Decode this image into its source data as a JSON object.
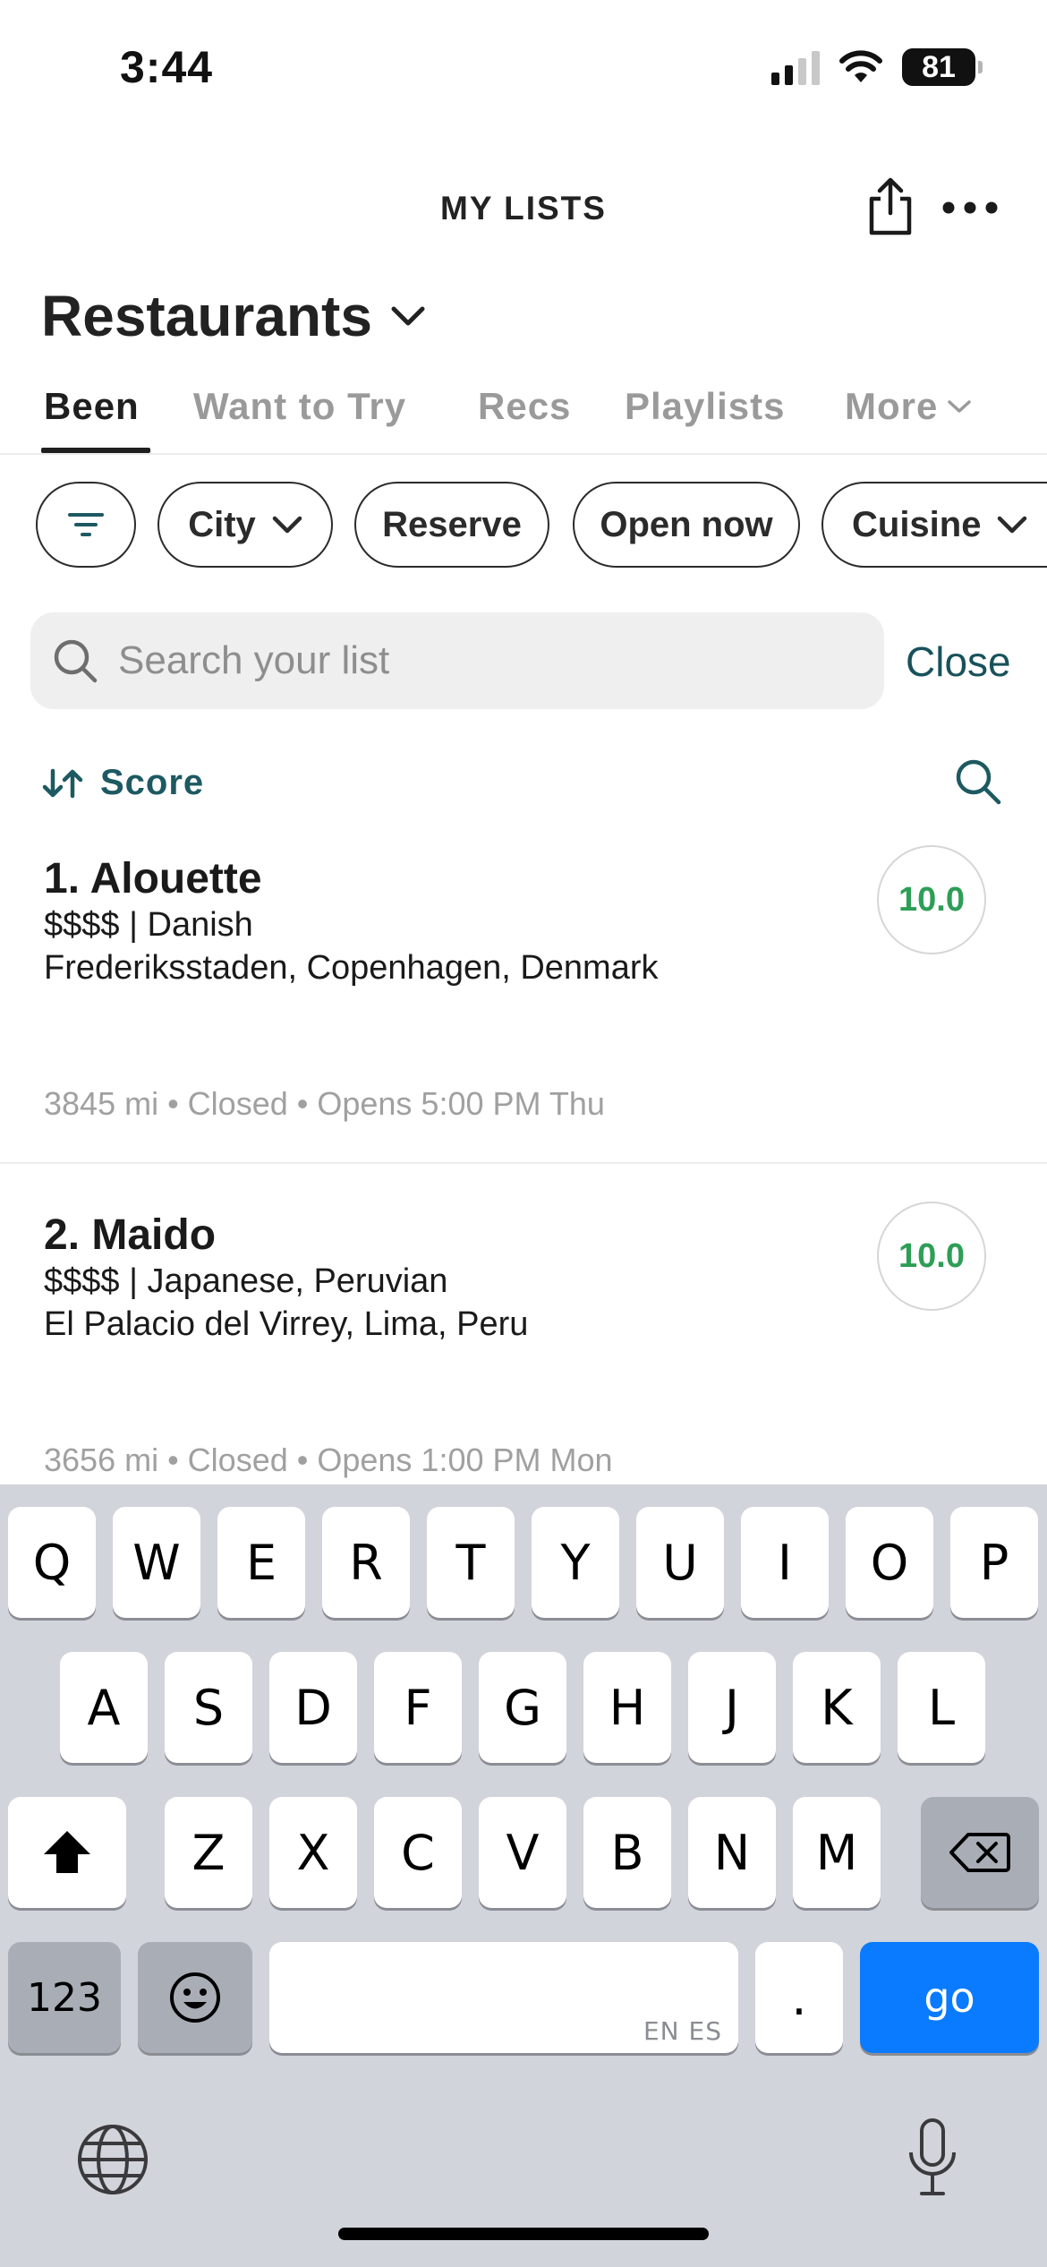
{
  "status_bar": {
    "time": "3:44",
    "battery": "81"
  },
  "header": {
    "title": "MY LISTS"
  },
  "list": {
    "title": "Restaurants"
  },
  "tabs": [
    {
      "label": "Been"
    },
    {
      "label": "Want to Try"
    },
    {
      "label": "Recs"
    },
    {
      "label": "Playlists"
    },
    {
      "label": "More"
    }
  ],
  "filters": [
    {
      "label": "City"
    },
    {
      "label": "Reserve"
    },
    {
      "label": "Open now"
    },
    {
      "label": "Cuisine"
    }
  ],
  "search": {
    "placeholder": "Search your list",
    "value": "",
    "close_label": "Close"
  },
  "sort": {
    "label": "Score"
  },
  "restaurants": [
    {
      "name": "1. Alouette",
      "price_cuisine": "$$$$ | Danish",
      "location": "Frederiksstaden, Copenhagen, Denmark",
      "meta": "3845 mi • Closed • Opens 5:00 PM Thu",
      "score": "10.0"
    },
    {
      "name": "2. Maido",
      "price_cuisine": "$$$$ | Japanese, Peruvian",
      "location": "El Palacio del Virrey, Lima, Peru",
      "meta": "3656 mi • Closed • Opens 1:00 PM Mon",
      "score": "10.0"
    }
  ],
  "keyboard": {
    "row1": [
      "Q",
      "W",
      "E",
      "R",
      "T",
      "Y",
      "U",
      "I",
      "O",
      "P"
    ],
    "row2": [
      "A",
      "S",
      "D",
      "F",
      "G",
      "H",
      "J",
      "K",
      "L"
    ],
    "row3": [
      "Z",
      "X",
      "C",
      "V",
      "B",
      "N",
      "M"
    ],
    "numbers_label": "123",
    "space_lang": "EN ES",
    "period_label": ".",
    "go_label": "go"
  },
  "colors": {
    "accent": "#1d5961",
    "score_green": "#2e9e57",
    "go_blue": "#0a7aff"
  }
}
